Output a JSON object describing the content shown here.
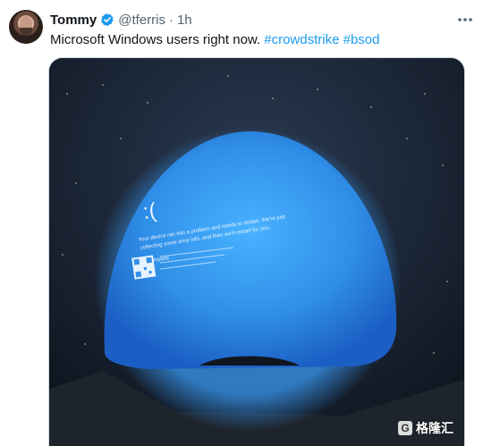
{
  "tweet": {
    "display_name": "Tommy",
    "handle": "@tferris",
    "separator": "·",
    "time": "1h",
    "text_plain": "Microsoft Windows users right now.",
    "hashtags": [
      "#crowdstrike",
      "#bsod"
    ]
  },
  "screen": {
    "line1": "Your device ran into a problem and needs to restart. We're just",
    "line2": "collecting some error info, and then we'll restart for you.",
    "complete": "0% complete"
  },
  "watermark": "格隆汇",
  "colors": {
    "link": "#1d9bf0",
    "verified": "#1d9bf0",
    "bsod_blue": "#2e8fe8",
    "muted": "#536471"
  },
  "icons": {
    "verified": "verified-badge-icon",
    "more": "more-icon"
  }
}
